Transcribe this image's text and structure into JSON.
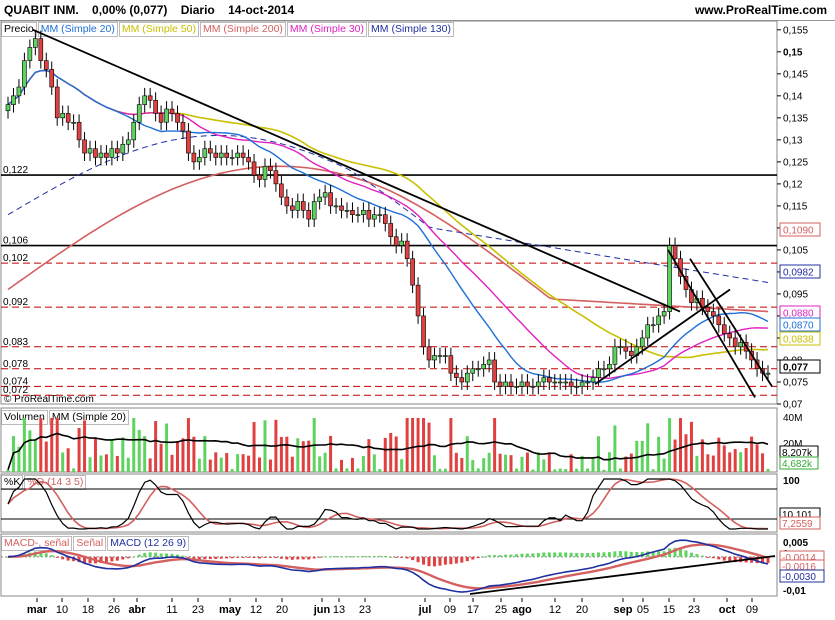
{
  "header": {
    "ticker": "QUABIT INM.",
    "change": "0,00% (0,077)",
    "period": "Diario",
    "date": "14-oct-2014",
    "site": "www.ProRealTime.com"
  },
  "legend_price": [
    {
      "label": "Precio",
      "color": "#000000"
    },
    {
      "label": "MM (Simple 20)",
      "color": "#1e6fd6"
    },
    {
      "label": "MM (Simple 50)",
      "color": "#c8c000"
    },
    {
      "label": "MM (Simple 200)",
      "color": "#d46060"
    },
    {
      "label": "MM (Simple 30)",
      "color": "#e020c0"
    },
    {
      "label": "MM (Simple 130)",
      "color": "#2030a0"
    }
  ],
  "legend_volume": [
    {
      "label": "Volumen",
      "color": "#000000"
    },
    {
      "label": "MM (Simple 20)",
      "color": "#000000"
    }
  ],
  "legend_stoch": [
    {
      "label": "%K",
      "color": "#000000"
    },
    {
      "label": "%D (14 3 5)",
      "color": "#d46060"
    }
  ],
  "legend_macd": [
    {
      "label": "MACD-, señal",
      "color": "#d46060"
    },
    {
      "label": "Señal",
      "color": "#d46060"
    },
    {
      "label": "MACD (12 26 9)",
      "color": "#2030a0"
    }
  ],
  "copyright": "© ProRealTime.com",
  "chart_data": {
    "type": "candlestick",
    "x_axis_labels": [
      "mar",
      "10",
      "18",
      "26",
      "abr",
      "11",
      "23",
      "may",
      "12",
      "20",
      "jun",
      "13",
      "23",
      "jul",
      "09",
      "17",
      "25",
      "ago",
      "12",
      "20",
      "sep",
      "05",
      "15",
      "23",
      "oct",
      "09"
    ],
    "price_panel": {
      "yticks": [
        "0,155",
        "0,15",
        "0,145",
        "0,14",
        "0,135",
        "0,13",
        "0,125",
        "0,12",
        "0,115",
        "0,11",
        "0,105",
        "0,1",
        "0,095",
        "0,09",
        "0,085",
        "0,08",
        "0,075",
        "0,07"
      ],
      "ylim": [
        0.07,
        0.157
      ],
      "horizontal_levels": [
        {
          "value": 0.122,
          "label": "0,122",
          "style": "solid"
        },
        {
          "value": 0.106,
          "label": "0,106",
          "style": "solid"
        },
        {
          "value": 0.102,
          "label": "0,102",
          "style": "dashed"
        },
        {
          "value": 0.092,
          "label": "0,092",
          "style": "dashed"
        },
        {
          "value": 0.083,
          "label": "0,083",
          "style": "dashed"
        },
        {
          "value": 0.078,
          "label": "0,078",
          "style": "dashed"
        },
        {
          "value": 0.074,
          "label": "0,074",
          "style": "dashed"
        },
        {
          "value": 0.072,
          "label": "0,072",
          "style": "dashed"
        }
      ],
      "price_close": [
        0.138,
        0.14,
        0.142,
        0.148,
        0.151,
        0.153,
        0.148,
        0.146,
        0.142,
        0.135,
        0.136,
        0.134,
        0.134,
        0.13,
        0.127,
        0.128,
        0.126,
        0.127,
        0.126,
        0.128,
        0.127,
        0.129,
        0.13,
        0.134,
        0.138,
        0.14,
        0.139,
        0.136,
        0.134,
        0.137,
        0.136,
        0.134,
        0.132,
        0.127,
        0.125,
        0.126,
        0.128,
        0.127,
        0.126,
        0.127,
        0.126,
        0.126,
        0.127,
        0.126,
        0.125,
        0.122,
        0.121,
        0.124,
        0.123,
        0.12,
        0.117,
        0.115,
        0.114,
        0.116,
        0.114,
        0.112,
        0.116,
        0.117,
        0.118,
        0.115,
        0.115,
        0.114,
        0.114,
        0.113,
        0.113,
        0.114,
        0.112,
        0.113,
        0.113,
        0.111,
        0.108,
        0.106,
        0.107,
        0.103,
        0.097,
        0.09,
        0.083,
        0.08,
        0.081,
        0.081,
        0.081,
        0.077,
        0.076,
        0.075,
        0.077,
        0.078,
        0.078,
        0.079,
        0.08,
        0.075,
        0.074,
        0.075,
        0.074,
        0.074,
        0.075,
        0.074,
        0.074,
        0.075,
        0.076,
        0.075,
        0.075,
        0.075,
        0.075,
        0.074,
        0.074,
        0.075,
        0.075,
        0.076,
        0.078,
        0.078,
        0.079,
        0.083,
        0.083,
        0.082,
        0.081,
        0.083,
        0.085,
        0.088,
        0.088,
        0.09,
        0.091,
        0.106,
        0.103,
        0.099,
        0.096,
        0.093,
        0.094,
        0.092,
        0.091,
        0.09,
        0.088,
        0.086,
        0.085,
        0.083,
        0.084,
        0.082,
        0.08,
        0.078,
        0.077,
        0.077
      ],
      "ma_labels": [
        {
          "value": "0,1090",
          "color": "#d46060"
        },
        {
          "value": "0,0982",
          "color": "#2030a0"
        },
        {
          "value": "0,0880",
          "color": "#e020c0"
        },
        {
          "value": "0,0870",
          "color": "#1e6fd6"
        },
        {
          "value": "0,0838",
          "color": "#c8c000"
        },
        {
          "value": "0,077",
          "color": "#000000"
        }
      ]
    },
    "volume_panel": {
      "yticks": [
        "40M",
        "20M"
      ],
      "ma_labels": [
        {
          "value": "8,207k",
          "color": "#000000"
        },
        {
          "value": "4,682k",
          "color": "#3a3"
        }
      ]
    },
    "stoch_panel": {
      "yticks": [
        "100",
        "0"
      ],
      "ma_labels": [
        {
          "value": "10,101",
          "color": "#000000"
        },
        {
          "value": "7,2559",
          "color": "#d46060"
        }
      ]
    },
    "macd_panel": {
      "yticks": [
        "0,005",
        "0",
        "-0,01"
      ],
      "ma_labels": [
        {
          "value": "-0,0014",
          "color": "#d46060"
        },
        {
          "value": "-0,0016",
          "color": "#d46060"
        },
        {
          "value": "-0,0030",
          "color": "#2030a0"
        }
      ]
    }
  }
}
